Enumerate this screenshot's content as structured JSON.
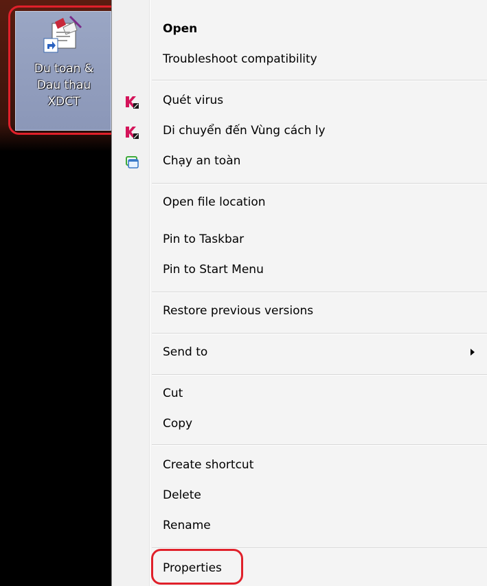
{
  "desktop": {
    "shortcut": {
      "label": "Du toan &\nDau thau\nXDCT",
      "icon": "program-shortcut-icon"
    }
  },
  "context_menu": {
    "items": [
      {
        "label": "Open",
        "bold": true
      },
      {
        "label": "Troubleshoot compatibility"
      },
      {
        "label": "Quét virus",
        "icon": "kaspersky-icon"
      },
      {
        "label": "Di chuyển đến Vùng cách ly",
        "icon": "kaspersky-icon"
      },
      {
        "label": "Chạy an toàn",
        "icon": "safe-run-icon"
      },
      {
        "label": "Open file location"
      },
      {
        "label": "Pin to Taskbar"
      },
      {
        "label": "Pin to Start Menu"
      },
      {
        "label": "Restore previous versions"
      },
      {
        "label": "Send to",
        "submenu": true
      },
      {
        "label": "Cut"
      },
      {
        "label": "Copy"
      },
      {
        "label": "Create shortcut"
      },
      {
        "label": "Delete"
      },
      {
        "label": "Rename"
      },
      {
        "label": "Properties"
      }
    ]
  },
  "colors": {
    "highlight": "#e0202a",
    "menu_bg": "#f4f4f4",
    "kaspersky_red": "#d4145a",
    "safe_run_green": "#3ca838"
  }
}
